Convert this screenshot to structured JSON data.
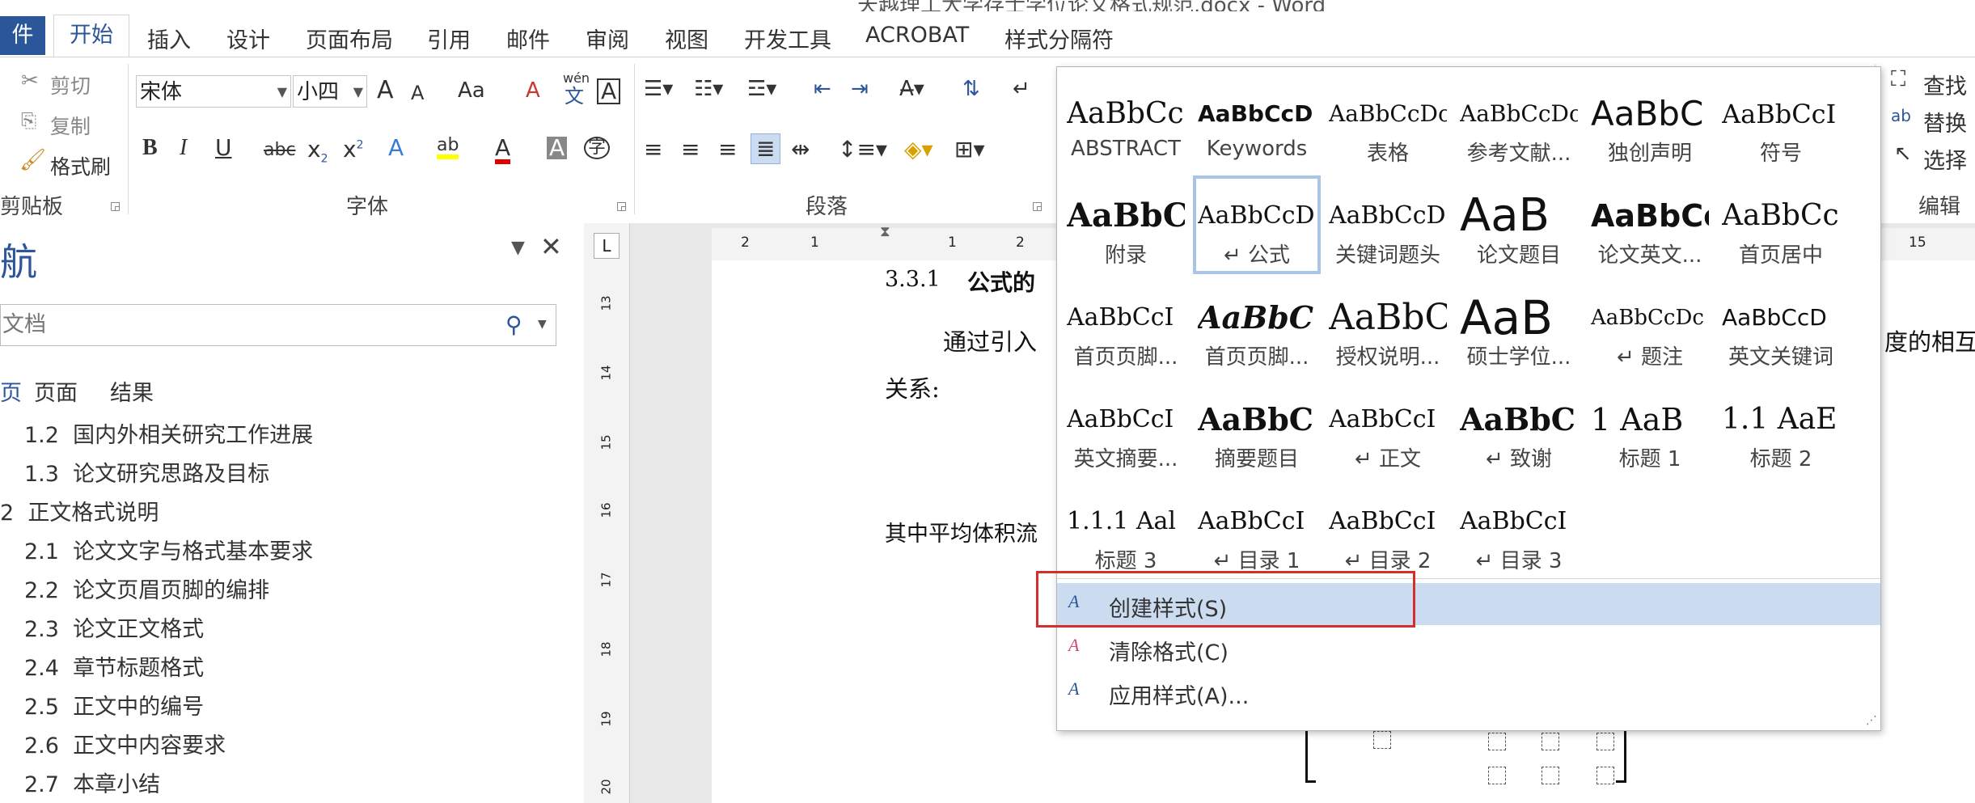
{
  "title_fragment": "天越理工大学存士学位论文格式规范.docx - Word",
  "tabs": {
    "file": "件",
    "items": [
      "开始",
      "插入",
      "设计",
      "页面布局",
      "引用",
      "邮件",
      "审阅",
      "视图",
      "开发工具",
      "ACROBAT",
      "样式分隔符"
    ],
    "active": "开始"
  },
  "ribbon": {
    "clipboard": {
      "cut": "剪切",
      "copy": "复制",
      "format_painter": "格式刷",
      "label": "剪贴板"
    },
    "font": {
      "name": "宋体",
      "size": "小四",
      "label": "字体",
      "grow": "A",
      "shrink": "A",
      "case": "Aa",
      "clear": "A",
      "phonetic": "文",
      "phonetic_top": "wén",
      "border": "A",
      "bold": "B",
      "italic": "I",
      "underline": "U",
      "strike": "abc",
      "sub": "x",
      "sub_mark": "2",
      "sup": "x",
      "sup_mark": "2",
      "effects": "A",
      "highlight": "ab",
      "color": "A",
      "shade": "A",
      "enclose": "字"
    },
    "paragraph": {
      "label": "段落"
    },
    "editing": {
      "find": "查找",
      "replace": "替换",
      "select": "选择",
      "label": "编辑"
    }
  },
  "nav": {
    "title": "航",
    "search_placeholder": "文档",
    "subtabs": [
      "页",
      "页面",
      "结果"
    ],
    "items": [
      {
        "num": "1.2",
        "text": "国内外相关研究工作进展"
      },
      {
        "num": "1.3",
        "text": "论文研究思路及目标"
      },
      {
        "num": "2",
        "text": "正文格式说明"
      },
      {
        "num": "2.1",
        "text": "论文文字与格式基本要求"
      },
      {
        "num": "2.2",
        "text": "论文页眉页脚的编排"
      },
      {
        "num": "2.3",
        "text": "论文正文格式"
      },
      {
        "num": "2.4",
        "text": "章节标题格式"
      },
      {
        "num": "2.5",
        "text": "正文中的编号"
      },
      {
        "num": "2.6",
        "text": "正文中内容要求"
      },
      {
        "num": "2.7",
        "text": "本章小结"
      }
    ]
  },
  "ruler": {
    "h_ticks": [
      "2",
      "1",
      "1",
      "2",
      "15"
    ],
    "v_ticks": [
      "13",
      "14",
      "15",
      "16",
      "17",
      "18",
      "19",
      "20"
    ]
  },
  "document": {
    "heading_num": "3.3.1",
    "heading": "公式的",
    "line1": "通过引入",
    "line1_end": "度的相互",
    "line2": "关系:",
    "line3": "其中平均体积流"
  },
  "gallery": {
    "styles": [
      {
        "preview": "AaBbCc",
        "name": "ABSTRACT"
      },
      {
        "preview": "AaBbCcD",
        "name": "Keywords"
      },
      {
        "preview": "AaBbCcDc",
        "name": "表格"
      },
      {
        "preview": "AaBbCcDc",
        "name": "参考文献..."
      },
      {
        "preview": "AaBbC",
        "name": "独创声明"
      },
      {
        "preview": "AaBbCcI",
        "name": "符号"
      },
      {
        "preview": "AaBbC",
        "name": "附录"
      },
      {
        "preview": "AaBbCcD",
        "name": "↵ 公式"
      },
      {
        "preview": "AaBbCcDc",
        "name": "关键词题头"
      },
      {
        "preview": "AaB",
        "name": "论文题目"
      },
      {
        "preview": "AaBbCc",
        "name": "论文英文..."
      },
      {
        "preview": "AaBbCc",
        "name": "首页居中"
      },
      {
        "preview": "AaBbCcI",
        "name": "首页页脚..."
      },
      {
        "preview": "AaBbC",
        "name": "首页页脚..."
      },
      {
        "preview": "AaBbC",
        "name": "授权说明..."
      },
      {
        "preview": "AaB",
        "name": "硕士学位..."
      },
      {
        "preview": "AaBbCcDc",
        "name": "↵ 题注"
      },
      {
        "preview": "AaBbCcD",
        "name": "英文关键词"
      },
      {
        "preview": "AaBbCcI",
        "name": "英文摘要..."
      },
      {
        "preview": "AaBbC",
        "name": "摘要题目"
      },
      {
        "preview": "AaBbCcI",
        "name": "↵ 正文"
      },
      {
        "preview": "AaBbC",
        "name": "↵ 致谢"
      },
      {
        "preview": "1  AaB",
        "name": "标题 1"
      },
      {
        "preview": "1.1  AaE",
        "name": "标题 2"
      },
      {
        "preview": "1.1.1  Aal",
        "name": "标题 3"
      },
      {
        "preview": "AaBbCcI",
        "name": "↵ 目录 1"
      },
      {
        "preview": "AaBbCcI",
        "name": "↵ 目录 2"
      },
      {
        "preview": "AaBbCcI",
        "name": "↵ 目录 3"
      }
    ],
    "commands": [
      {
        "label": "创建样式(S)",
        "icon": "A"
      },
      {
        "label": "清除格式(C)",
        "icon": "A"
      },
      {
        "label": "应用样式(A)...",
        "icon": "A"
      }
    ]
  },
  "colors": {
    "accent": "#2b579a",
    "highlight": "#d42f2f",
    "selection": "#cbdcf0"
  }
}
